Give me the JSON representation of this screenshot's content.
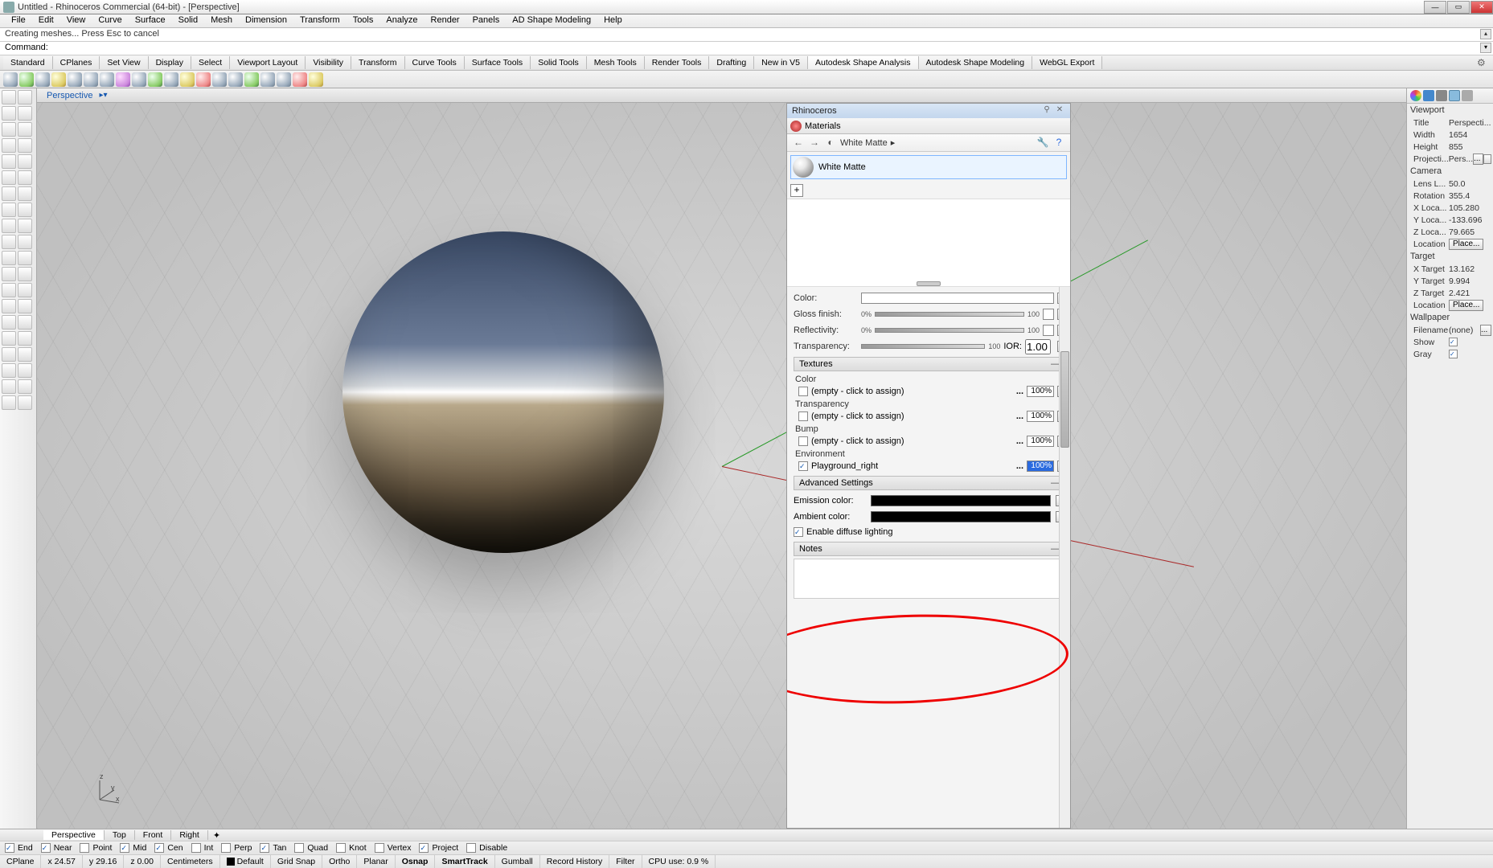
{
  "titlebar": {
    "title": "Untitled - Rhinoceros Commercial (64-bit) - [Perspective]"
  },
  "menubar": [
    "File",
    "Edit",
    "View",
    "Curve",
    "Surface",
    "Solid",
    "Mesh",
    "Dimension",
    "Transform",
    "Tools",
    "Analyze",
    "Render",
    "Panels",
    "AD Shape Modeling",
    "Help"
  ],
  "command_echo": "Creating meshes... Press Esc to cancel",
  "command_prompt": "Command:",
  "toolbar_tabs": [
    "Standard",
    "CPlanes",
    "Set View",
    "Display",
    "Select",
    "Viewport Layout",
    "Visibility",
    "Transform",
    "Curve Tools",
    "Surface Tools",
    "Solid Tools",
    "Mesh Tools",
    "Render Tools",
    "Drafting",
    "New in V5",
    "Autodesk Shape Analysis",
    "Autodesk Shape Modeling",
    "WebGL Export"
  ],
  "active_toolbar_tab": "Autodesk Shape Analysis",
  "viewport_label": "Perspective",
  "float_panel": {
    "title": "Rhinoceros",
    "tab_label": "Materials",
    "breadcrumb": "White Matte",
    "material_name": "White Matte",
    "props": {
      "color_lbl": "Color:",
      "gloss_lbl": "Gloss finish:",
      "gloss_lo": "0%",
      "gloss_hi": "100",
      "refl_lbl": "Reflectivity:",
      "refl_lo": "0%",
      "refl_hi": "100",
      "trans_lbl": "Transparency:",
      "trans_hi": "100",
      "ior_lbl": "IOR:",
      "ior_val": "1.00"
    },
    "textures_hdr": "Textures",
    "tex": {
      "color_hdr": "Color",
      "color_val": "(empty - click to assign)",
      "color_pct": "100%",
      "trans_hdr": "Transparency",
      "trans_val": "(empty - click to assign)",
      "trans_pct": "100%",
      "bump_hdr": "Bump",
      "bump_val": "(empty - click to assign)",
      "bump_pct": "100%",
      "env_hdr": "Environment",
      "env_val": "Playground_right",
      "env_pct": "100%"
    },
    "adv_hdr": "Advanced Settings",
    "emiss_lbl": "Emission color:",
    "amb_lbl": "Ambient color:",
    "diffuse_cb": "Enable diffuse lighting",
    "notes_hdr": "Notes"
  },
  "right_panel": {
    "viewport_hdr": "Viewport",
    "title_k": "Title",
    "title_v": "Perspecti...",
    "width_k": "Width",
    "width_v": "1654",
    "height_k": "Height",
    "height_v": "855",
    "proj_k": "Projecti...",
    "proj_v": "Pers...",
    "camera_hdr": "Camera",
    "lens_k": "Lens L...",
    "lens_v": "50.0",
    "rot_k": "Rotation",
    "rot_v": "355.4",
    "xl_k": "X Loca...",
    "xl_v": "105.280",
    "yl_k": "Y Loca...",
    "yl_v": "-133.696",
    "zl_k": "Z Loca...",
    "zl_v": "79.665",
    "loc_k": "Location",
    "place_btn": "Place...",
    "target_hdr": "Target",
    "xt_k": "X Target",
    "xt_v": "13.162",
    "yt_k": "Y Target",
    "yt_v": "9.994",
    "zt_k": "Z Target",
    "zt_v": "2.421",
    "loc2_k": "Location",
    "wall_hdr": "Wallpaper",
    "file_k": "Filename",
    "file_v": "(none)",
    "show_k": "Show",
    "gray_k": "Gray"
  },
  "bottom_tabs": [
    "Perspective",
    "Top",
    "Front",
    "Right"
  ],
  "osnap": {
    "items": [
      {
        "k": "End",
        "c": true
      },
      {
        "k": "Near",
        "c": true
      },
      {
        "k": "Point",
        "c": false
      },
      {
        "k": "Mid",
        "c": true
      },
      {
        "k": "Cen",
        "c": true
      },
      {
        "k": "Int",
        "c": false
      },
      {
        "k": "Perp",
        "c": false
      },
      {
        "k": "Tan",
        "c": true
      },
      {
        "k": "Quad",
        "c": false
      },
      {
        "k": "Knot",
        "c": false
      },
      {
        "k": "Vertex",
        "c": false
      },
      {
        "k": "Project",
        "c": true
      },
      {
        "k": "Disable",
        "c": false
      }
    ]
  },
  "statusbar": {
    "cplane": "CPlane",
    "x": "x 24.57",
    "y": "y 29.16",
    "z": "z 0.00",
    "units": "Centimeters",
    "layer": "Default",
    "cells": [
      "Grid Snap",
      "Ortho",
      "Planar",
      "Osnap",
      "SmartTrack",
      "Gumball",
      "Record History",
      "Filter"
    ],
    "bold": [
      "Osnap",
      "SmartTrack"
    ],
    "cpu": "CPU use: 0.9 %"
  }
}
